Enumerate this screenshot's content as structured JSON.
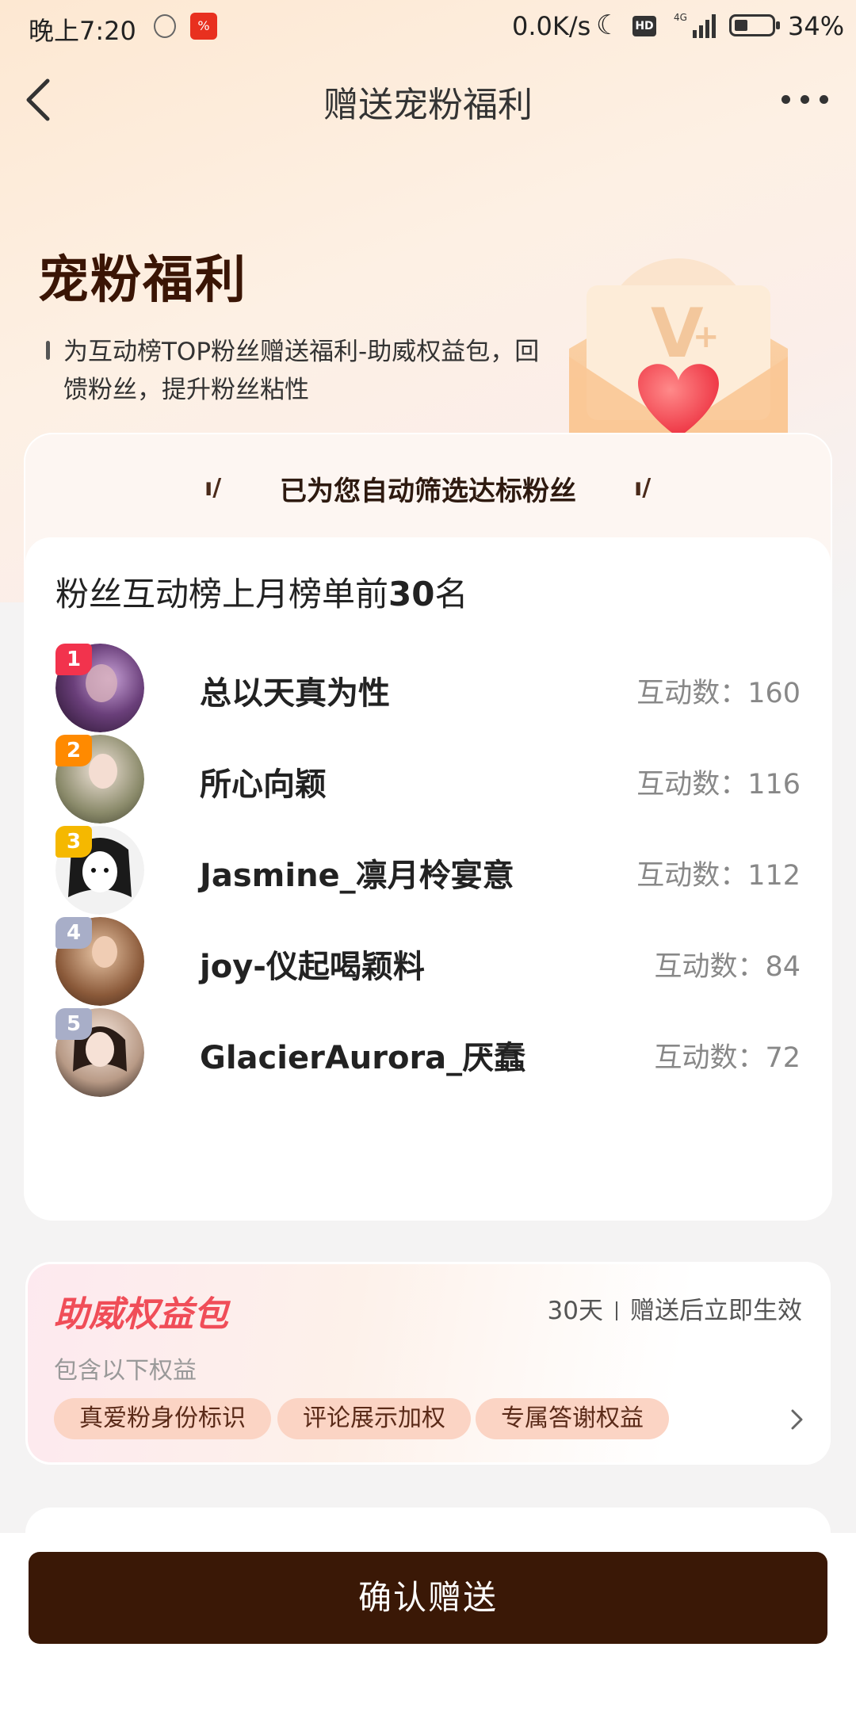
{
  "status": {
    "time": "晚上7:20",
    "network_speed": "0.0K/s",
    "hd": "HD",
    "signal": "4G",
    "battery": "34%"
  },
  "nav": {
    "title": "赠送宠粉福利"
  },
  "hero": {
    "title": "宠粉福利",
    "desc": "为互动榜TOP粉丝赠送福利-助威权益包，回馈粉丝，提升粉丝粘性"
  },
  "filter": {
    "heading": "已为您自动筛选达标粉丝"
  },
  "list": {
    "title_prefix": "粉丝互动榜上月榜单前",
    "title_number": "30",
    "title_suffix": "名",
    "fans": [
      {
        "rank": "1",
        "name": "总以天真为性",
        "stat": "互动数：160"
      },
      {
        "rank": "2",
        "name": "所心向颖",
        "stat": "互动数：116"
      },
      {
        "rank": "3",
        "name": "Jasmine_凛月柃宴意",
        "stat": "互动数：112"
      },
      {
        "rank": "4",
        "name": "joy-仪起喝颖料",
        "stat": "互动数：84"
      },
      {
        "rank": "5",
        "name": "GlacierAurora_厌蠢",
        "stat": "互动数：72"
      }
    ]
  },
  "benefit": {
    "title": "助威权益包",
    "duration": "30天",
    "effect": "赠送后立即生效",
    "subtitle": "包含以下权益",
    "tags": [
      "真爱粉身份标识",
      "评论展示加权",
      "专属答谢权益"
    ]
  },
  "footer": {
    "confirm_label": "确认赠送"
  },
  "colors": {
    "accent_dark": "#3a1806",
    "rank1": "#f2334d",
    "rank2": "#ff8a00",
    "rank3": "#f5b800",
    "rank_other": "#a8aec8",
    "benefit_title": "#f04d58"
  }
}
